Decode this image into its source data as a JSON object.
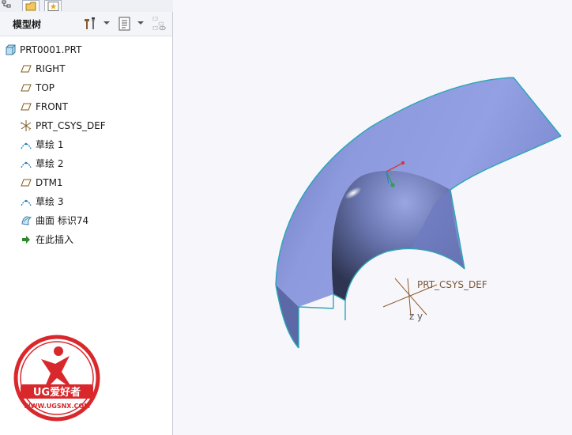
{
  "panel": {
    "title": "模型树"
  },
  "tree": {
    "items": [
      {
        "label": "PRT0001.PRT",
        "icon": "part-icon"
      },
      {
        "label": "RIGHT",
        "icon": "datum-plane-icon"
      },
      {
        "label": "TOP",
        "icon": "datum-plane-icon"
      },
      {
        "label": "FRONT",
        "icon": "datum-plane-icon"
      },
      {
        "label": "PRT_CSYS_DEF",
        "icon": "csys-icon"
      },
      {
        "label": "草绘 1",
        "icon": "sketch-icon"
      },
      {
        "label": "草绘 2",
        "icon": "sketch-icon"
      },
      {
        "label": "DTM1",
        "icon": "datum-plane-icon"
      },
      {
        "label": "草绘 3",
        "icon": "sketch-icon"
      },
      {
        "label": "曲面 标识74",
        "icon": "surface-icon"
      },
      {
        "label": "在此插入",
        "icon": "insert-here-arrow-icon"
      }
    ]
  },
  "viewport": {
    "csys_label": "PRT_CSYS_DEF",
    "axis_z": "z",
    "axis_y": "y"
  },
  "watermark": {
    "brand": "UG爱好者",
    "url": "WWW.UGSNX.COM"
  },
  "colors": {
    "surface": "#8a97d9",
    "surface_dark": "#3f4868",
    "edge": "#2aa6b8",
    "logo_red": "#d8282c"
  }
}
